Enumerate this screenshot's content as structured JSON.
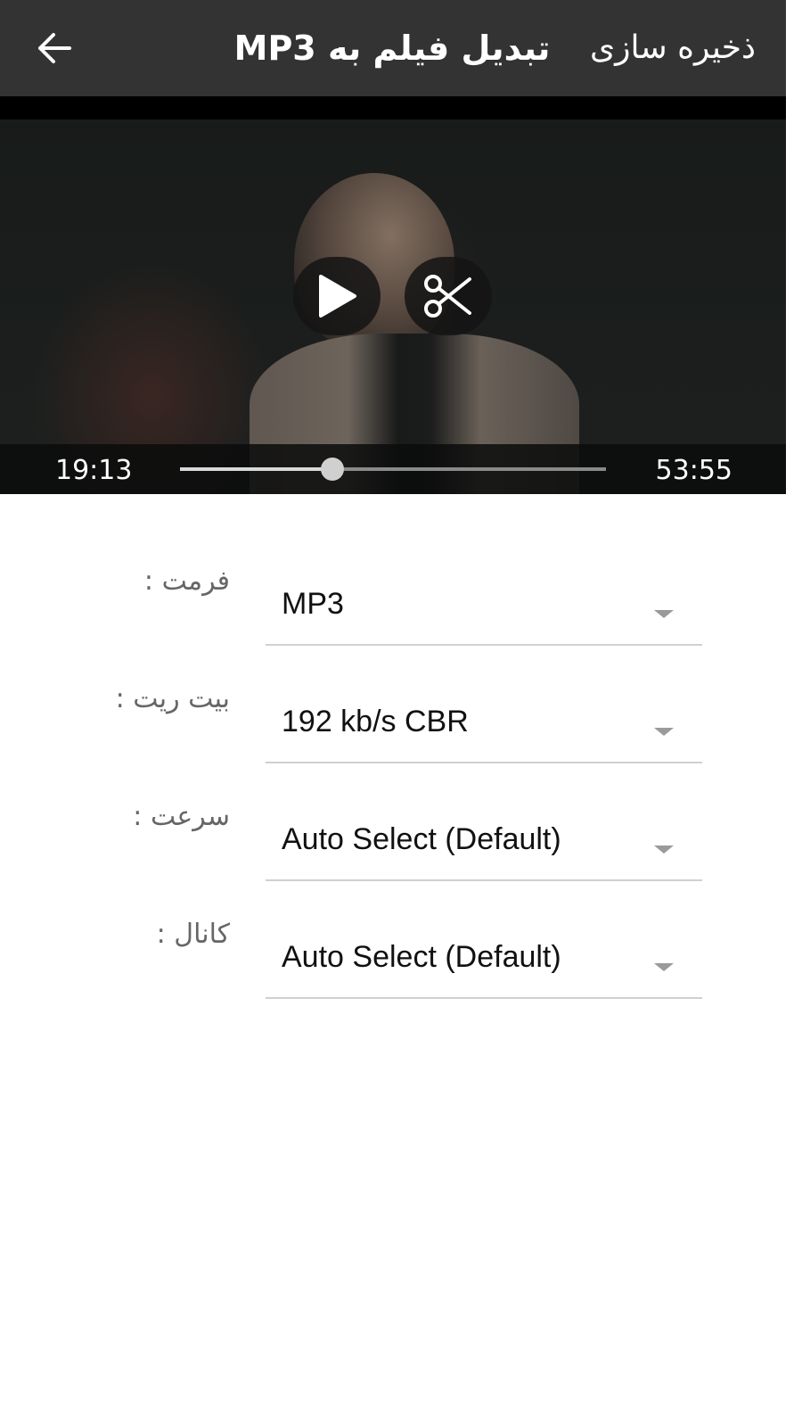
{
  "appbar": {
    "back_icon": "arrow-left-icon",
    "title": "تبدیل فیلم به MP3",
    "save_label": "ذخیره سازی"
  },
  "player": {
    "play_icon": "play-icon",
    "cut_icon": "scissors-icon",
    "current_time": "19:13",
    "total_time": "53:55",
    "progress_fraction": 0.357
  },
  "settings": [
    {
      "label": "فرمت :",
      "value": "MP3"
    },
    {
      "label": "بیت ریت :",
      "value": "192 kb/s CBR"
    },
    {
      "label": "سرعت :",
      "value": "Auto Select (Default)"
    },
    {
      "label": "کانال :",
      "value": "Auto Select (Default)"
    }
  ]
}
